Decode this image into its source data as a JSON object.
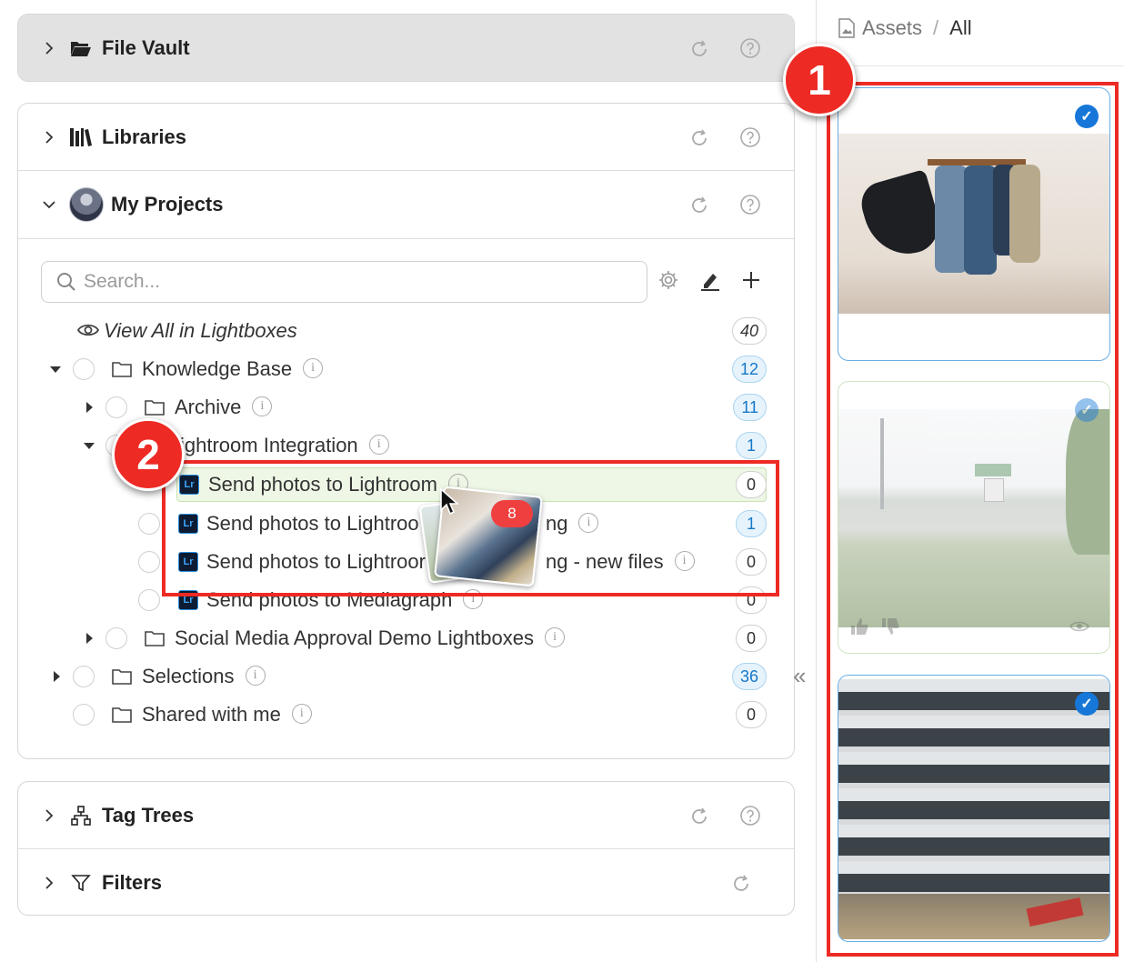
{
  "panels": {
    "file_vault": {
      "title": "File Vault"
    },
    "libraries": {
      "title": "Libraries"
    },
    "my_projects": {
      "title": "My Projects"
    },
    "tag_trees": {
      "title": "Tag Trees"
    },
    "filters": {
      "title": "Filters"
    }
  },
  "search": {
    "placeholder": "Search..."
  },
  "tree": {
    "view_all": {
      "label": "View All in Lightboxes",
      "count": "40"
    },
    "knowledge_base": {
      "label": "Knowledge Base",
      "count": "12"
    },
    "archive": {
      "label": "Archive",
      "count": "11"
    },
    "lightroom_integration": {
      "label": "ightroom Integration",
      "count": "1"
    },
    "send1": {
      "label": "Send photos to Lightroom",
      "count": "0"
    },
    "send2": {
      "label_a": "Send photos to Lightroo",
      "label_b": "ng",
      "count": "1"
    },
    "send3": {
      "label_a": "Send photos to Lightroor",
      "label_b": "ng - new files",
      "count": "0"
    },
    "send4": {
      "label": "Send photos to Mediagraph",
      "count": "0"
    },
    "social": {
      "label": "Social Media Approval Demo Lightboxes",
      "count": "0"
    },
    "selections": {
      "label": "Selections",
      "count": "36"
    },
    "shared": {
      "label": "Shared with me",
      "count": "0"
    }
  },
  "drag": {
    "count": "8"
  },
  "breadcrumb": {
    "root": "Assets",
    "separator": "/",
    "current": "All"
  },
  "markers": {
    "one": "1",
    "two": "2"
  },
  "icons": {
    "lr": "Lr",
    "info": "i",
    "check": "✓",
    "collapse": "«"
  },
  "colors": {
    "accent": "#1677d8",
    "annotation": "#ee2a24",
    "lightroom": "#0d1c33"
  }
}
